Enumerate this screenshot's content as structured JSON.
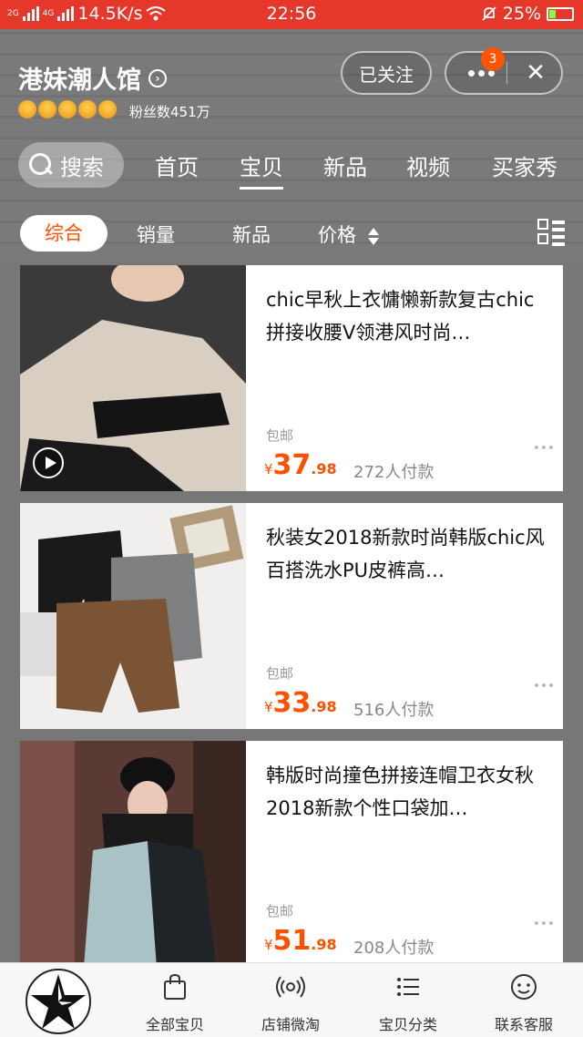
{
  "status_bar": {
    "net_2g": "2G",
    "net_4g": "4G",
    "speed": "14.5K/s",
    "time": "22:56",
    "battery": "25%",
    "battery_level": 0.25
  },
  "shop": {
    "name": "港妹潮人馆",
    "fans_label": "粉丝数451万",
    "crown_count": 5,
    "follow_label": "已关注",
    "notification_count": "3"
  },
  "nav": {
    "search_label": "搜索",
    "tabs": [
      "首页",
      "宝贝",
      "新品",
      "视频",
      "买家秀"
    ],
    "active_tab": "宝贝"
  },
  "sort": {
    "options": [
      "综合",
      "销量",
      "新品",
      "价格"
    ],
    "active": "综合"
  },
  "products": [
    {
      "title": "chic早秋上衣慵懒新款复古chic拼接收腰V领港风时尚…",
      "shipping": "包邮",
      "currency": "¥",
      "price_int": "37",
      "price_dec": ".98",
      "sold": "272人付款",
      "has_video": true
    },
    {
      "title": "秋装女2018新款时尚韩版chic风百搭洗水PU皮裤高…",
      "shipping": "包邮",
      "currency": "¥",
      "price_int": "33",
      "price_dec": ".98",
      "sold": "516人付款",
      "has_video": false
    },
    {
      "title": "韩版时尚撞色拼接连帽卫衣女秋2018新款个性口袋加…",
      "shipping": "包邮",
      "currency": "¥",
      "price_int": "51",
      "price_dec": ".98",
      "sold": "208人付款",
      "has_video": false
    }
  ],
  "bottom_bar": {
    "items": [
      "全部宝贝",
      "店铺微淘",
      "宝贝分类",
      "联系客服"
    ]
  },
  "colors": {
    "status_red": "#e5382b",
    "accent_orange": "#ff5000",
    "crown_gold": "#f0a020"
  },
  "icons": {
    "bottom": [
      "shopping-bag-icon",
      "broadcast-icon",
      "list-icon",
      "chat-face-icon"
    ]
  }
}
